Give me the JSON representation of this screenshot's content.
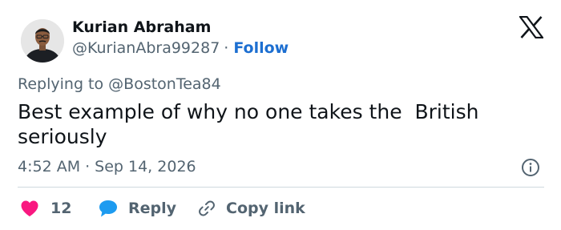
{
  "author": {
    "name": "Kurian Abraham",
    "handle": "@KurianAbra99287",
    "separator": "·",
    "follow_label": "Follow"
  },
  "tweet": {
    "replying_prefix": "Replying to ",
    "replying_handle": "@BostonTea84",
    "text": "Best example of why no one takes the  British seriously",
    "time": "4:52 AM",
    "separator": "·",
    "date": "Sep 14, 2026"
  },
  "actions": {
    "like_count": "12",
    "reply_label": "Reply",
    "copy_link_label": "Copy link"
  },
  "icons": {
    "brand": "x-logo-icon",
    "info": "info-icon",
    "like": "heart-icon",
    "reply": "speech-bubble-icon",
    "copy": "link-icon"
  },
  "colors": {
    "like": "#f91880",
    "reply": "#1d9bf0",
    "follow": "#1d6fd1",
    "secondary_text": "#536471",
    "primary_text": "#0f1419",
    "divider": "#cfd9de"
  }
}
